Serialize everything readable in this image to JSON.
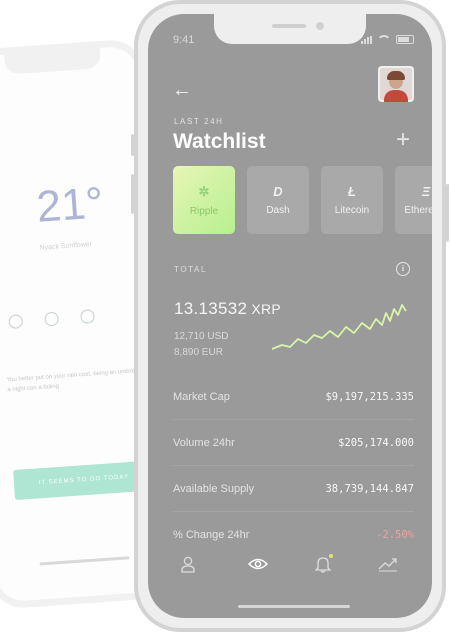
{
  "back_phone": {
    "temperature": "21°",
    "subtitle": "Nyack Sunflower",
    "body_text": "You better put on your rain coat, being an umbrella, a night can a failing",
    "button_label": "IT SEEMS TO GO TODAY"
  },
  "status": {
    "time": "9:41"
  },
  "header": {
    "kicker": "LAST 24H",
    "title": "Watchlist"
  },
  "coins": [
    {
      "name": "Ripple",
      "glyph": "✲",
      "selected": true
    },
    {
      "name": "Dash",
      "glyph": "D",
      "selected": false
    },
    {
      "name": "Litecoin",
      "glyph": "Ł",
      "selected": false
    },
    {
      "name": "Ethereum",
      "glyph": "Ξ",
      "selected": false
    }
  ],
  "total": {
    "label": "TOTAL",
    "amount": "13.13532",
    "unit": "XRP",
    "sub1": "12,710 USD",
    "sub2": "8,890 EUR"
  },
  "stats": [
    {
      "label": "Market Cap",
      "value": "$9,197,215.335",
      "negative": false
    },
    {
      "label": "Volume 24hr",
      "value": "$205,174.000",
      "negative": false
    },
    {
      "label": "Available Supply",
      "value": "38,739,144.847",
      "negative": false
    },
    {
      "label": "% Change 24hr",
      "value": "-2.50%",
      "negative": true
    }
  ],
  "tabs": [
    "profile-icon",
    "eye-icon",
    "bell-icon",
    "trend-icon"
  ],
  "colors": {
    "accent": "#b6f08f",
    "negative": "#e8a3a3",
    "screen": "#9a9a9a"
  }
}
